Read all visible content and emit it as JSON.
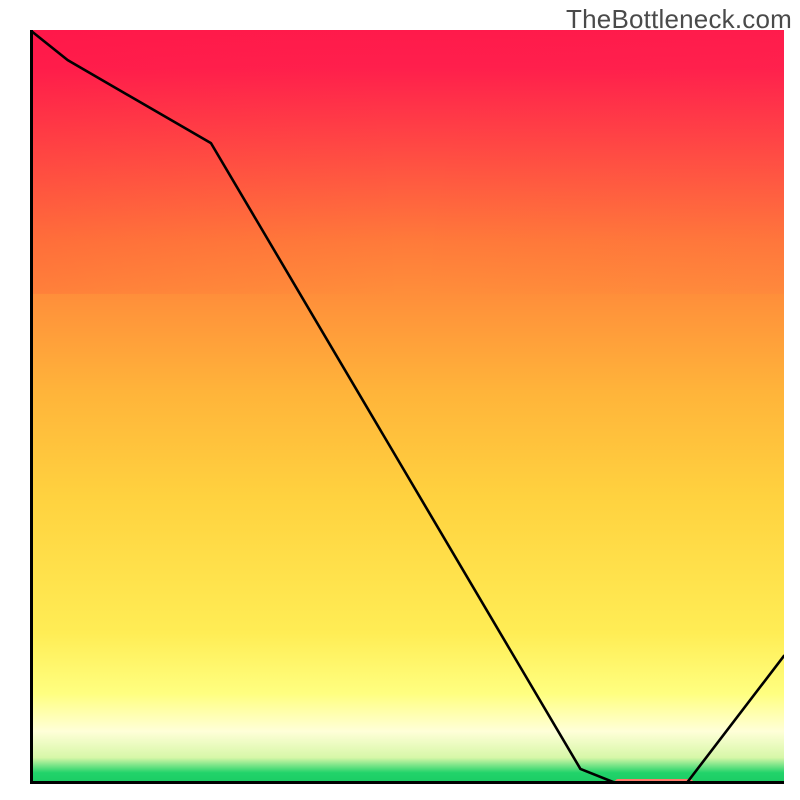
{
  "watermark": "TheBottleneck.com",
  "chart_data": {
    "type": "line",
    "title": "",
    "xlabel": "",
    "ylabel": "",
    "xlim": [
      0,
      100
    ],
    "ylim": [
      0,
      100
    ],
    "x": [
      0,
      5,
      24,
      73,
      78,
      87,
      100
    ],
    "values": [
      100,
      96,
      85,
      2,
      0,
      0,
      17
    ],
    "annotations": [
      {
        "type": "segment",
        "x0": 78,
        "x1": 87.5,
        "y": 0.2,
        "color": "#ff7b6b"
      }
    ],
    "background_gradient": {
      "top_left": "#ff1a4b",
      "top_right": "#ff284b",
      "mid": "#ffd23f",
      "lower": "#ffff80",
      "white_band": "#ffffd8",
      "bottom": "#22d36a"
    }
  }
}
